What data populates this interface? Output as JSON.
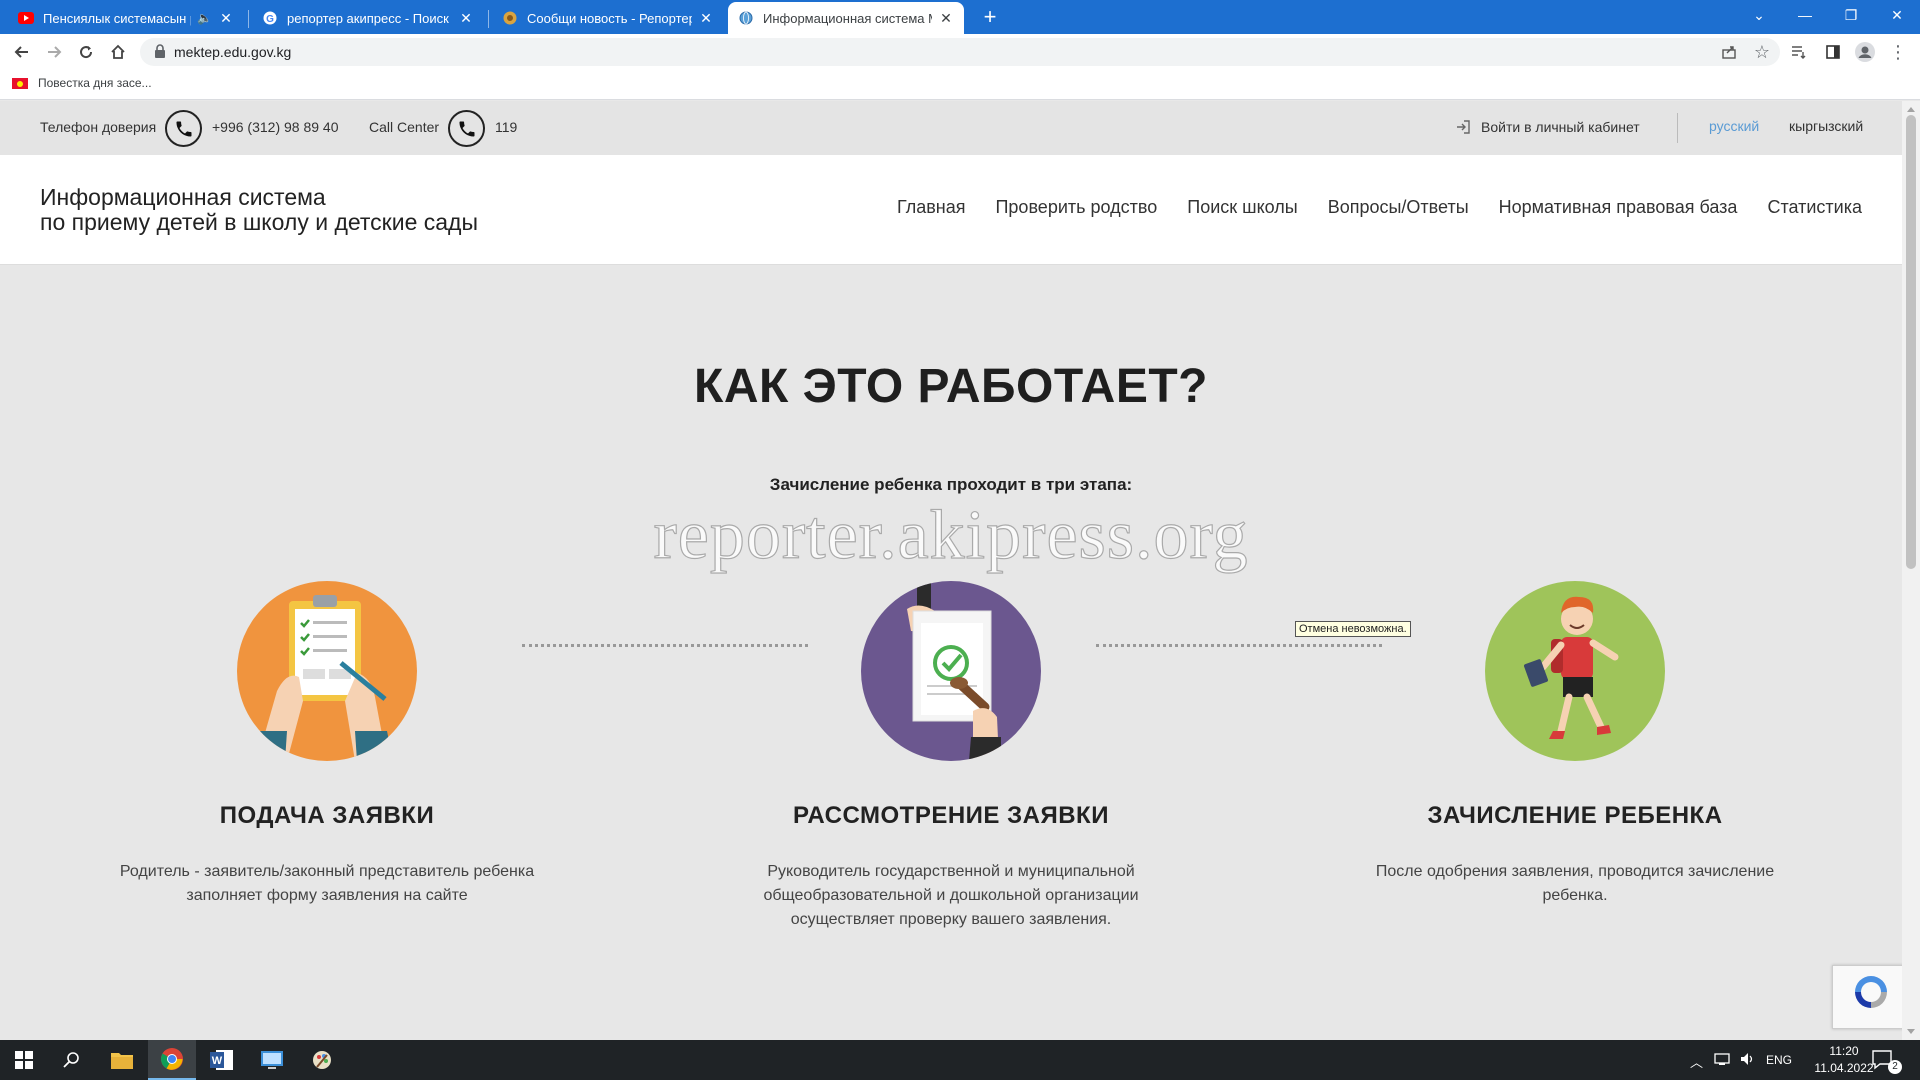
{
  "browser": {
    "tabs": [
      {
        "title": "Пенсиялык системасын ре",
        "favicon": "youtube-icon",
        "audio": true
      },
      {
        "title": "репортер акипресс - Поиск в G",
        "favicon": "google-icon"
      },
      {
        "title": "Сообщи новость - Репортер",
        "favicon": "reporter-icon"
      },
      {
        "title": "Информационная система МО",
        "favicon": "globe-icon",
        "active": true
      }
    ],
    "url": "mektep.edu.gov.kg",
    "bookmark": "Повестка дня засе..."
  },
  "topbar": {
    "hotline_label": "Телефон доверия",
    "hotline_number": "+996 (312) 98 89 40",
    "callcenter_label": "Call Center",
    "callcenter_number": "119",
    "login_label": "Войти в личный кабинет",
    "lang_ru": "русский",
    "lang_ky": "кыргызский"
  },
  "header": {
    "brand_line1": "Информационная система",
    "brand_line2": "по приему детей в школу и детские сады",
    "nav": [
      "Главная",
      "Проверить родство",
      "Поиск школы",
      "Вопросы/Ответы",
      "Нормативная правовая база",
      "Статистика"
    ]
  },
  "main": {
    "title": "КАК ЭТО РАБОТАЕТ?",
    "subtitle": "Зачисление ребенка проходит в три этапа:",
    "watermark": "reporter.akipress.org",
    "tooltip": "Отмена невозможна.",
    "steps": [
      {
        "title": "ПОДАЧА ЗАЯВКИ",
        "desc": "Родитель - заявитель/законный представитель ребенка заполняет форму заявления на сайте",
        "color": "#f0943e",
        "icon": "clipboard-checklist-icon"
      },
      {
        "title": "РАССМОТРЕНИЕ ЗАЯВКИ",
        "desc": "Руководитель государственной и муниципальной общеобразовательной и дошкольной организации осуществляет проверку вашего заявления.",
        "color": "#6b578f",
        "icon": "document-stamp-icon"
      },
      {
        "title": "ЗАЧИСЛЕНИЕ РЕБЕНКА",
        "desc": "После одобрения заявления, проводится зачисление ребенка.",
        "color": "#9fc45a",
        "icon": "schoolboy-icon"
      }
    ]
  },
  "taskbar": {
    "lang": "ENG",
    "time": "11:20",
    "date": "11.04.2022",
    "notifications": "2"
  },
  "colors": {
    "chrome_blue": "#1d6fd0",
    "link_blue": "#5a9bd4",
    "page_bg": "#e7e7e7"
  }
}
